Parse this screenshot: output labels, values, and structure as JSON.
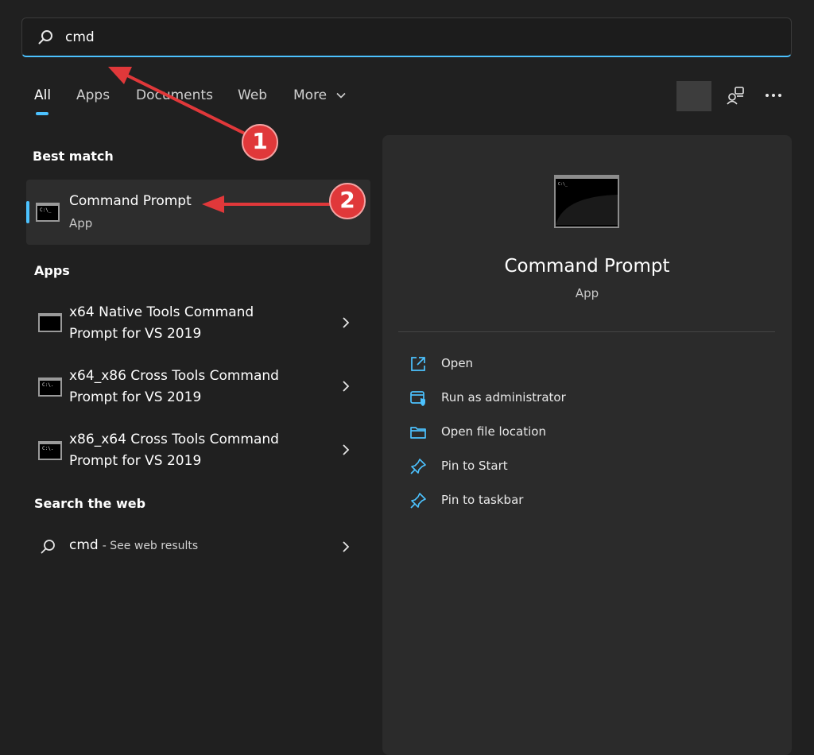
{
  "search": {
    "value": "cmd"
  },
  "tabs": [
    {
      "label": "All",
      "active": true
    },
    {
      "label": "Apps"
    },
    {
      "label": "Documents"
    },
    {
      "label": "Web"
    },
    {
      "label": "More"
    }
  ],
  "toolbar": {
    "account_icon": "people-icon",
    "more_icon": "ellipsis-icon"
  },
  "best_match": {
    "heading": "Best match",
    "title": "Command Prompt",
    "subtitle": "App",
    "icon_text": "C:\\_"
  },
  "apps": {
    "heading": "Apps",
    "items": [
      {
        "line1": "x64 Native Tools Command",
        "line2": "Prompt for VS 2019",
        "icon_text": ""
      },
      {
        "line1": "x64_x86 Cross Tools Command",
        "line2": "Prompt for VS 2019",
        "icon_text": "C:\\."
      },
      {
        "line1": "x86_x64 Cross Tools Command",
        "line2": "Prompt for VS 2019",
        "icon_text": "C:\\."
      }
    ]
  },
  "web": {
    "heading": "Search the web",
    "query": "cmd",
    "suffix": "- See web results"
  },
  "details": {
    "title": "Command Prompt",
    "subtitle": "App",
    "actions": [
      {
        "label": "Open",
        "icon": "open-external-icon"
      },
      {
        "label": "Run as administrator",
        "icon": "shield-window-icon"
      },
      {
        "label": "Open file location",
        "icon": "folder-icon"
      },
      {
        "label": "Pin to Start",
        "icon": "pin-icon"
      },
      {
        "label": "Pin to taskbar",
        "icon": "pin-icon"
      }
    ]
  },
  "annotations": [
    {
      "number": "1"
    },
    {
      "number": "2"
    }
  ],
  "colors": {
    "accent": "#4cc2ff",
    "annotation": "#e0383a",
    "background": "#202020",
    "panel": "#2b2b2b"
  }
}
